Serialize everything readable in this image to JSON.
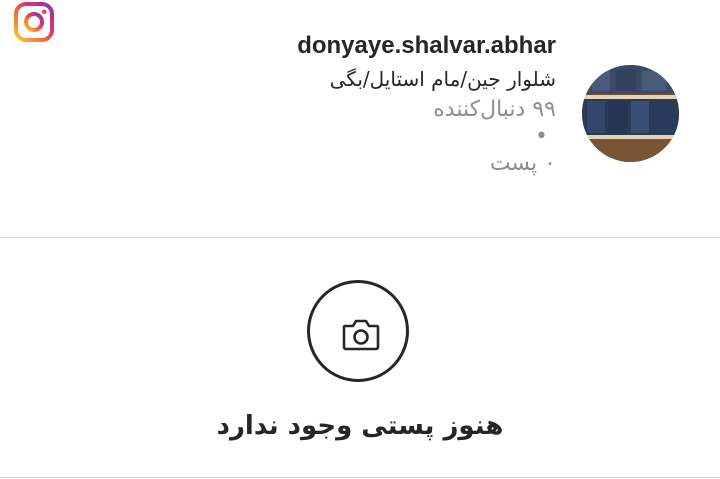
{
  "app": {
    "logo_icon": "instagram-logo-icon"
  },
  "profile": {
    "username": "donyaye.shalvar.abhar",
    "bio": "شلوار جین/مام استایل/بگی",
    "followers": "۹۹ دنبال‌کننده",
    "separator": "•",
    "posts": "۰ پست",
    "avatar_icon": "jeans-stack-avatar"
  },
  "empty_state": {
    "icon": "camera-icon",
    "message": "هنوز پستی وجود ندارد"
  },
  "colors": {
    "text_primary": "#262626",
    "text_secondary": "#8e8e8e",
    "divider": "#dbdbdb"
  }
}
